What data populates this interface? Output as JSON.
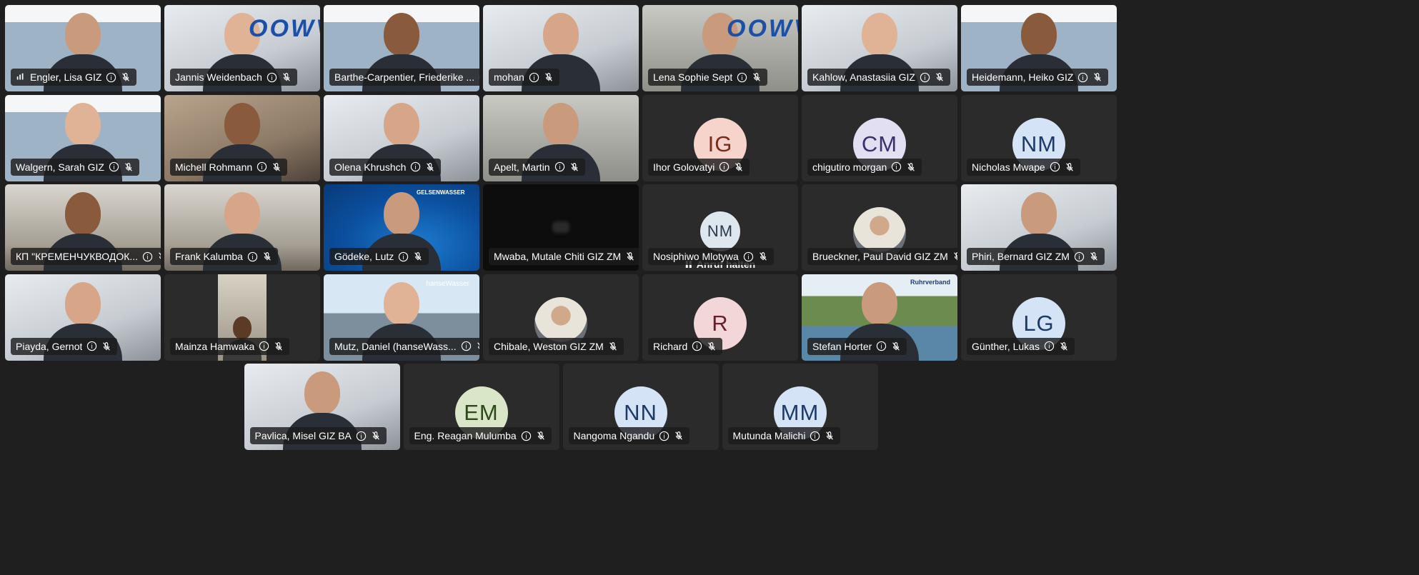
{
  "colors": {
    "background": "#1f1f1f",
    "tile": "#2b2b2b",
    "label_bg": "#1c1c1c",
    "label_text": "#ffffff"
  },
  "rows": [
    [
      {
        "name": "Engler, Lisa GIZ",
        "kind": "video",
        "bg": "v-slide",
        "status": "speaking"
      },
      {
        "name": "Jannis Weidenbach",
        "kind": "video",
        "bg": "v-white",
        "status": "muted",
        "logo": "OOWV"
      },
      {
        "name": "Barthe-Carpentier, Friederike ...",
        "kind": "video",
        "bg": "v-slide",
        "status": "muted"
      },
      {
        "name": "mohan",
        "kind": "video",
        "bg": "v-white",
        "status": "muted"
      },
      {
        "name": "Lena Sophie Sept",
        "kind": "video",
        "bg": "v-grey",
        "status": "muted",
        "logo": "OOWV"
      },
      {
        "name": "Kahlow, Anastasiia GIZ",
        "kind": "video",
        "bg": "v-white",
        "status": "muted"
      },
      {
        "name": "Heidemann, Heiko GIZ",
        "kind": "video",
        "bg": "v-slide",
        "status": "muted"
      }
    ],
    [
      {
        "name": "Walgern, Sarah GIZ",
        "kind": "video",
        "bg": "v-slide",
        "status": "muted"
      },
      {
        "name": "Michell Rohmann",
        "kind": "video",
        "bg": "v-warm",
        "status": "muted"
      },
      {
        "name": "Olena Khrushch",
        "kind": "video",
        "bg": "v-white",
        "status": "muted"
      },
      {
        "name": "Apelt, Martin",
        "kind": "video",
        "bg": "v-grey",
        "status": "muted"
      },
      {
        "name": "Ihor Golovatyi",
        "kind": "avatar",
        "initials": "IG",
        "avatar_bg": "#f6d4cc",
        "avatar_fg": "#7a2b1c",
        "status": "muted"
      },
      {
        "name": "chigutiro morgan",
        "kind": "avatar",
        "initials": "CM",
        "avatar_bg": "#e3dff3",
        "avatar_fg": "#3c2f6e",
        "status": "muted"
      },
      {
        "name": "Nicholas Mwape",
        "kind": "avatar",
        "initials": "NM",
        "avatar_bg": "#d4e4f6",
        "avatar_fg": "#1d3a6b",
        "status": "muted"
      }
    ],
    [
      {
        "name": "КП \"КРЕМЕНЧУКВОДОК...",
        "kind": "video",
        "bg": "v-room",
        "status": "muted"
      },
      {
        "name": "Frank Kalumba",
        "kind": "video",
        "bg": "v-room",
        "status": "muted"
      },
      {
        "name": "Gödeke, Lutz",
        "kind": "video",
        "bg": "v-blue",
        "status": "muted",
        "brand": "GELSENWASSER"
      },
      {
        "name": "Mwaba, Mutale Chiti GIZ ZM",
        "kind": "dark",
        "status": "muted"
      },
      {
        "name": "Nosiphiwo Mlotywa",
        "kind": "avatar-small",
        "initials": "NM",
        "avatar_bg": "#dfe7ee",
        "avatar_fg": "#2b3a4a",
        "hold": "Anruf halten",
        "status": "muted"
      },
      {
        "name": "Brueckner, Paul David GIZ ZM",
        "kind": "photo-avatar",
        "status": "muted"
      },
      {
        "name": "Phiri, Bernard GIZ ZM",
        "kind": "video",
        "bg": "v-white",
        "status": "muted"
      }
    ],
    [
      {
        "name": "Piayda, Gernot",
        "kind": "video",
        "bg": "v-white",
        "status": "muted"
      },
      {
        "name": "Mainza Hamwaka",
        "kind": "video-narrow",
        "status": "muted"
      },
      {
        "name": "Mutz, Daniel (hanseWass...",
        "kind": "video",
        "bg": "v-sky",
        "status": "muted",
        "brand": "hanseWasser"
      },
      {
        "name": "Chibale, Weston GIZ ZM",
        "kind": "photo-avatar",
        "status": "muted"
      },
      {
        "name": "Richard",
        "kind": "avatar",
        "initials": "R",
        "avatar_bg": "#f3d6d8",
        "avatar_fg": "#6b1f2a",
        "status": "muted"
      },
      {
        "name": "Stefan Horter",
        "kind": "video",
        "bg": "v-river",
        "status": "muted",
        "brand": "Ruhrverband"
      },
      {
        "name": "Günther, Lukas",
        "kind": "avatar",
        "initials": "LG",
        "avatar_bg": "#d4e4f6",
        "avatar_fg": "#1d3a6b",
        "status": "muted"
      }
    ],
    [
      {
        "name": "Pavlica, Misel GIZ BA",
        "kind": "video",
        "bg": "v-white",
        "status": "muted"
      },
      {
        "name": "Eng. Reagan Mulumba",
        "kind": "avatar",
        "initials": "EM",
        "avatar_bg": "#d9e7c8",
        "avatar_fg": "#2f4a1a",
        "status": "muted"
      },
      {
        "name": "Nangoma Ngandu",
        "kind": "avatar",
        "initials": "NN",
        "avatar_bg": "#d4e4f6",
        "avatar_fg": "#1d3a6b",
        "status": "muted"
      },
      {
        "name": "Mutunda Malichi",
        "kind": "avatar",
        "initials": "MM",
        "avatar_bg": "#d4e4f6",
        "avatar_fg": "#1d3a6b",
        "status": "muted"
      }
    ]
  ]
}
